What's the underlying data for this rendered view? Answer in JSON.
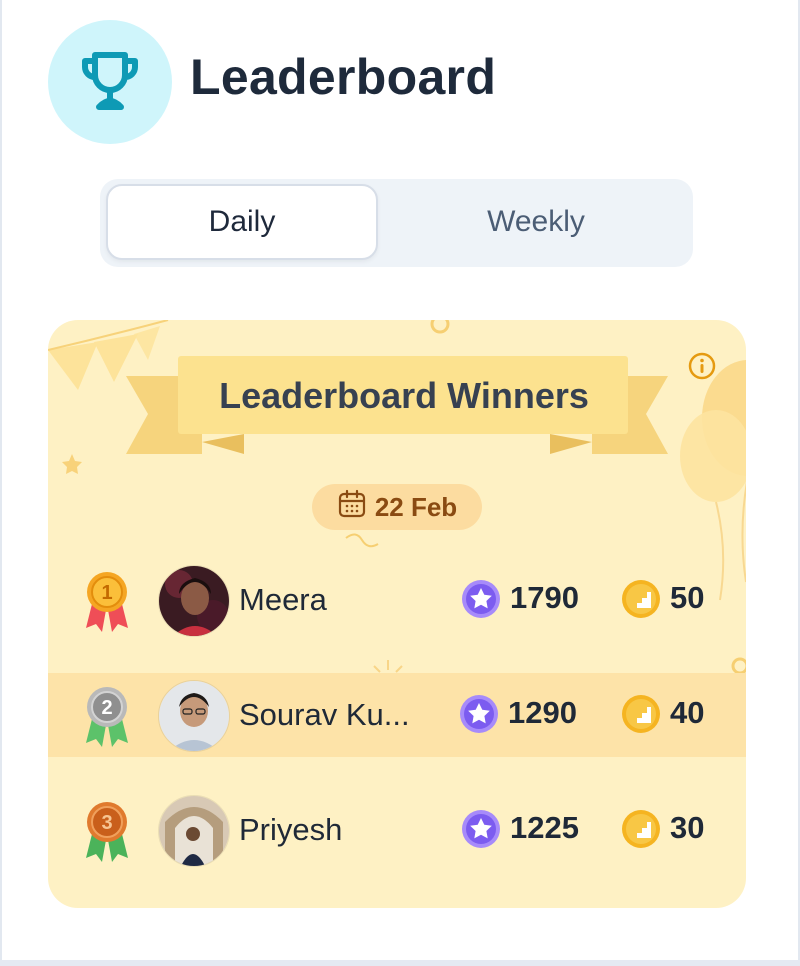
{
  "header": {
    "title": "Leaderboard",
    "icon": "trophy-icon",
    "icon_bg": "#cff5fb",
    "icon_color": "#0e9ab5"
  },
  "tabs": [
    {
      "label": "Daily",
      "active": true
    },
    {
      "label": "Weekly",
      "active": false
    }
  ],
  "winners_card": {
    "title": "Leaderboard Winners",
    "info_icon": "info-icon",
    "date_icon": "calendar-icon",
    "date": "22 Feb",
    "background": "#fef1c4",
    "highlight": "#fde3a8",
    "rows": [
      {
        "rank": "1",
        "medal": "gold",
        "name": "Meera",
        "points": "1790",
        "streak": "50"
      },
      {
        "rank": "2",
        "medal": "silver",
        "name": "Sourav Ku...",
        "points": "1290",
        "streak": "40",
        "highlighted": true
      },
      {
        "rank": "3",
        "medal": "bronze",
        "name": "Priyesh",
        "points": "1225",
        "streak": "30"
      }
    ]
  },
  "colors": {
    "gold": "#f5a623",
    "silver": "#9e9e9e",
    "bronze": "#d96f25",
    "star_purple": "#7c5cf0",
    "step_orange": "#f5b421"
  }
}
